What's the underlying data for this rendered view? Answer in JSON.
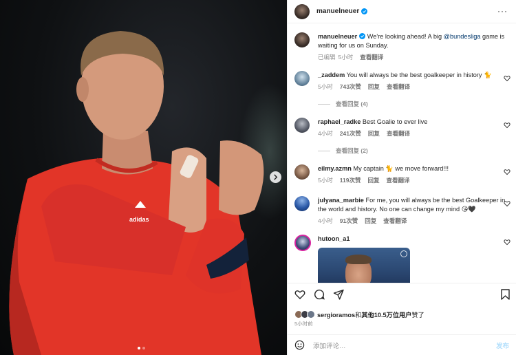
{
  "post": {
    "author": "manuelneuer",
    "caption_author": "manuelneuer",
    "caption_pre": "We're looking ahead! A big ",
    "caption_mention": "@bundesliga",
    "caption_post": " game is waiting for us on Sunday.",
    "caption_status": "已编辑",
    "caption_time": "5小时",
    "caption_translate": "查看翻译"
  },
  "media": {
    "carousel_count": 2,
    "carousel_active": 1,
    "shirt_brand": "adidas"
  },
  "comments": [
    {
      "user": "_zaddem",
      "text": "You will always be the best goalkeeper in history 🐈",
      "time": "5小时",
      "likes": "743次赞",
      "reply": "回复",
      "translate": "查看翻译",
      "view_replies": "查看回复 (4)"
    },
    {
      "user": "raphael_radke",
      "text": "Best Goalie to ever live",
      "time": "4小时",
      "likes": "241次赞",
      "reply": "回复",
      "translate": "查看翻译",
      "view_replies": "查看回复 (2)"
    },
    {
      "user": "eilmy.azmn",
      "text": "My captain 🐈 we move forward!!!",
      "time": "5小时",
      "likes": "119次赞",
      "reply": "回复",
      "translate": "查看翻译"
    },
    {
      "user": "julyana_marbie",
      "text": "For me, you will always be the best Goalkeeper in the world and history. No one can change my mind 😘🖤",
      "time": "4小时",
      "likes": "91次赞",
      "reply": "回复",
      "translate": "查看翻译"
    },
    {
      "user": "hutoon_a1",
      "text": ""
    }
  ],
  "footer": {
    "likes_user": "sergioramos",
    "likes_mid": "和",
    "likes_other": "其他10.5万位用户",
    "likes_end": "赞了",
    "time": "5小时前",
    "comment_placeholder": "添加评论…",
    "post_label": "发布"
  },
  "colors": {
    "link": "#00376b",
    "verified": "#0095f6",
    "meta": "#8e8e8e",
    "shirt": "#e8362a"
  },
  "icons": [
    "more-icon",
    "verified-icon",
    "heart-icon",
    "comment-icon",
    "share-icon",
    "bookmark-icon",
    "emoji-icon",
    "next-arrow-icon"
  ]
}
